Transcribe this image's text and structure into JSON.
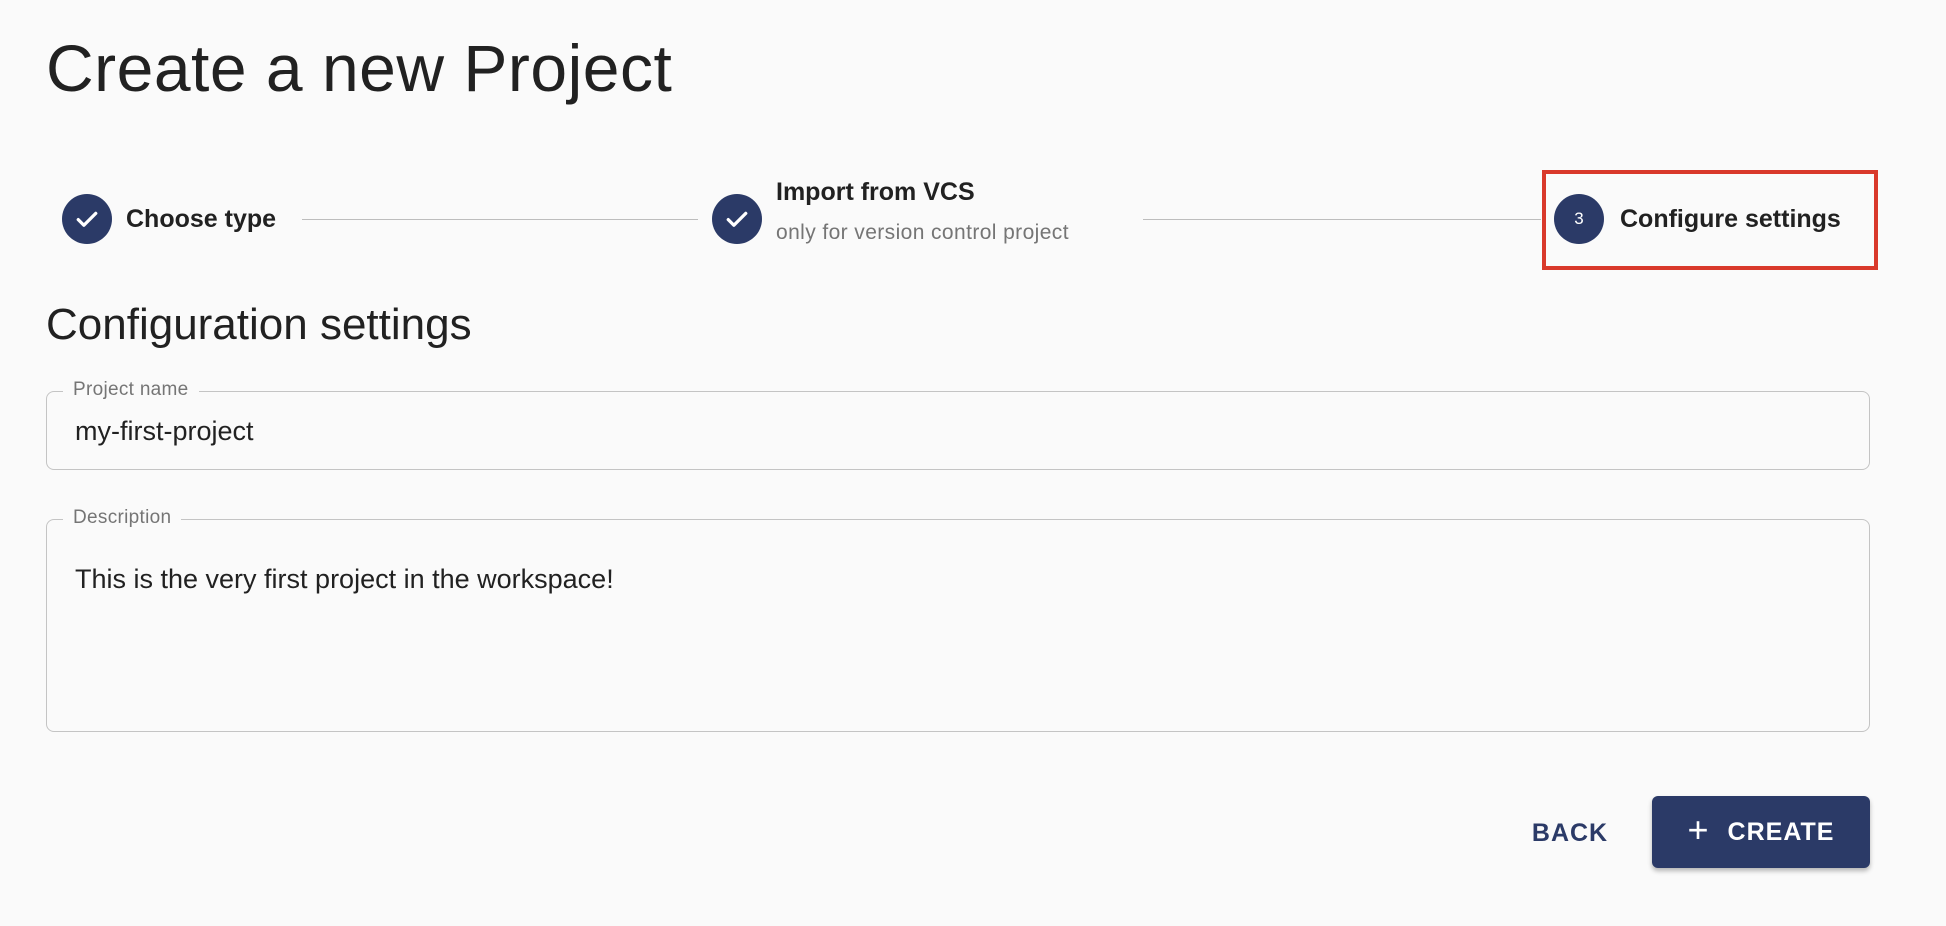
{
  "page": {
    "title": "Create a new Project"
  },
  "stepper": {
    "steps": [
      {
        "label": "Choose type",
        "status": "completed",
        "icon": "check-icon"
      },
      {
        "label": "Import from VCS",
        "sublabel": "only for version control project",
        "status": "completed",
        "icon": "check-icon"
      },
      {
        "label": "Configure settings",
        "status": "active",
        "number": "3"
      }
    ]
  },
  "section": {
    "title": "Configuration settings"
  },
  "form": {
    "project_name": {
      "label": "Project name",
      "value": "my-first-project"
    },
    "description": {
      "label": "Description",
      "value": "This is the very first project in the workspace!"
    }
  },
  "actions": {
    "back_label": "BACK",
    "create_label": "CREATE",
    "create_icon": "plus-icon"
  },
  "colors": {
    "primary": "#2b3a67",
    "highlight": "#d9392b",
    "background": "#fafafa",
    "border": "#c4c4c4"
  }
}
